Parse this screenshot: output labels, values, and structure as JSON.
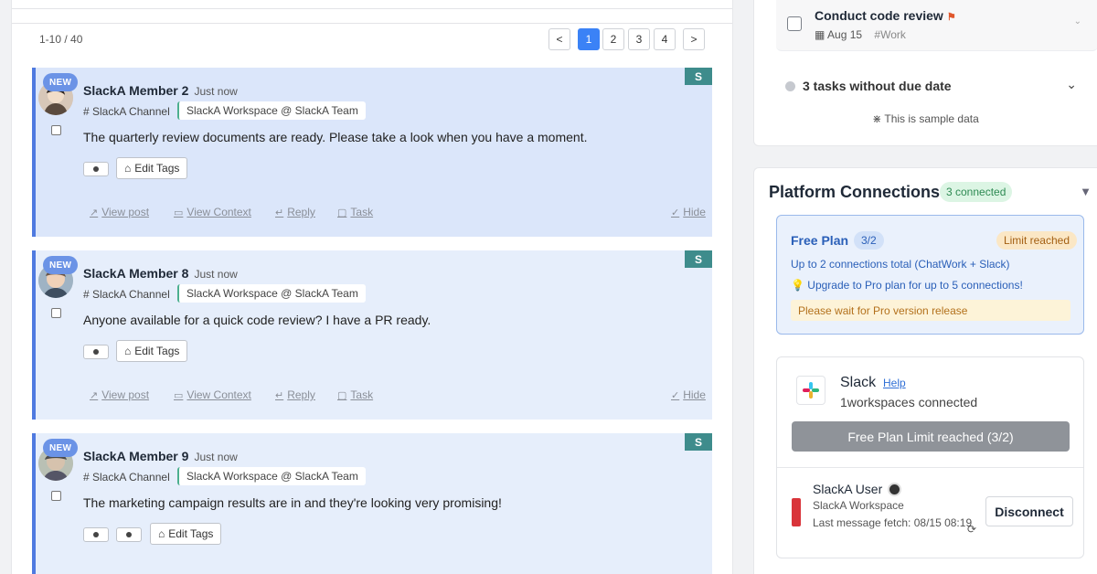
{
  "list": {
    "count_label": "1-10 / 40",
    "pager": {
      "prev": "<",
      "pages": [
        "1",
        "2",
        "3",
        "4"
      ],
      "next": ">"
    }
  },
  "posts": [
    {
      "new_badge": "NEW",
      "member": "SlackA Member 2",
      "time": "Just now",
      "channel": "# SlackA Channel",
      "workspace": "SlackA Workspace @ SlackA Team",
      "message": "The quarterly review documents are ready. Please take a look when you have a moment.",
      "source_badge": "S",
      "edit_tags": "Edit Tags",
      "actions": {
        "view_post": "View post",
        "view_context": "View Context",
        "reply": "Reply",
        "task": "Task",
        "hide": "Hide"
      }
    },
    {
      "new_badge": "NEW",
      "member": "SlackA Member 8",
      "time": "Just now",
      "channel": "# SlackA Channel",
      "workspace": "SlackA Workspace @ SlackA Team",
      "message": "Anyone available for a quick code review? I have a PR ready.",
      "source_badge": "S",
      "edit_tags": "Edit Tags",
      "actions": {
        "view_post": "View post",
        "view_context": "View Context",
        "reply": "Reply",
        "task": "Task",
        "hide": "Hide"
      }
    },
    {
      "new_badge": "NEW",
      "member": "SlackA Member 9",
      "time": "Just now",
      "channel": "# SlackA Channel",
      "workspace": "SlackA Workspace @ SlackA Team",
      "message": "The marketing campaign results are in and they're looking very promising!",
      "source_badge": "S",
      "edit_tags": "Edit Tags"
    }
  ],
  "tasks": {
    "item": {
      "title": "Conduct code review",
      "date": "Aug 15",
      "tag": "#Work"
    },
    "undated": "3 tasks without due date",
    "sample_note": "This is sample data"
  },
  "platform": {
    "title": "Platform Connections",
    "connected_badge": "3 connected",
    "plan": {
      "name": "Free Plan",
      "count": "3/2",
      "limit": "Limit reached",
      "description": "Up to 2 connections total (ChatWork + Slack)",
      "upgrade": "Upgrade to Pro plan for up to 5 connections!",
      "wait": "Please wait for Pro version release"
    },
    "slack": {
      "name": "Slack",
      "help": "Help",
      "connected": "1workspaces connected",
      "limit_button": "Free Plan Limit reached (3/2)",
      "user": {
        "name": "SlackA User",
        "workspace": "SlackA Workspace",
        "fetch": "Last message fetch: 08/15 08:19",
        "disconnect": "Disconnect"
      }
    }
  },
  "colors": {
    "accent": "#4f7ae0",
    "source_badge": "#3e8c8c",
    "connected": "#2e8a53",
    "limit": "#a35f12",
    "user_bar": "#d9343a"
  }
}
